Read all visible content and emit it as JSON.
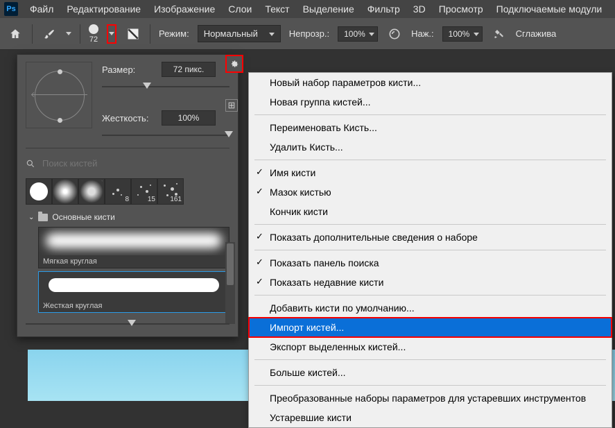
{
  "menubar": {
    "items": [
      "Файл",
      "Редактирование",
      "Изображение",
      "Слои",
      "Текст",
      "Выделение",
      "Фильтр",
      "3D",
      "Просмотр",
      "Подключаемые модули"
    ]
  },
  "optbar": {
    "brush_size": "72",
    "mode_label": "Режим:",
    "mode_value": "Нормальный",
    "opacity_label": "Непрозр.:",
    "opacity_value": "100%",
    "flow_label": "Наж.:",
    "flow_value": "100%",
    "smooth_label": "Сглажива"
  },
  "brush_panel": {
    "size_label": "Размер:",
    "size_value": "72 пикс.",
    "hardness_label": "Жесткость:",
    "hardness_value": "100%",
    "search_placeholder": "Поиск кистей",
    "thumb_labels": [
      "",
      "",
      "",
      "8",
      "15",
      "161"
    ],
    "folder_name": "Основные кисти",
    "brush_items": [
      {
        "label": "Мягкая круглая",
        "selected": false,
        "kind": "soft"
      },
      {
        "label": "Жесткая круглая",
        "selected": true,
        "kind": "hard"
      }
    ]
  },
  "context_menu": {
    "groups": [
      [
        {
          "t": "Новый набор параметров кисти..."
        },
        {
          "t": "Новая группа кистей..."
        }
      ],
      [
        {
          "t": "Переименовать Кисть..."
        },
        {
          "t": "Удалить Кисть..."
        }
      ],
      [
        {
          "t": "Имя кисти",
          "c": true
        },
        {
          "t": "Мазок кистью",
          "c": true
        },
        {
          "t": "Кончик кисти"
        }
      ],
      [
        {
          "t": "Показать дополнительные сведения о наборе",
          "c": true
        }
      ],
      [
        {
          "t": "Показать панель поиска",
          "c": true
        },
        {
          "t": "Показать недавние кисти",
          "c": true
        }
      ],
      [
        {
          "t": "Добавить кисти по умолчанию..."
        },
        {
          "t": "Импорт кистей...",
          "hl": true
        },
        {
          "t": "Экспорт выделенных кистей..."
        }
      ],
      [
        {
          "t": "Больше кистей..."
        }
      ],
      [
        {
          "t": "Преобразованные наборы параметров для устаревших инструментов"
        },
        {
          "t": "Устаревшие кисти"
        }
      ]
    ]
  }
}
